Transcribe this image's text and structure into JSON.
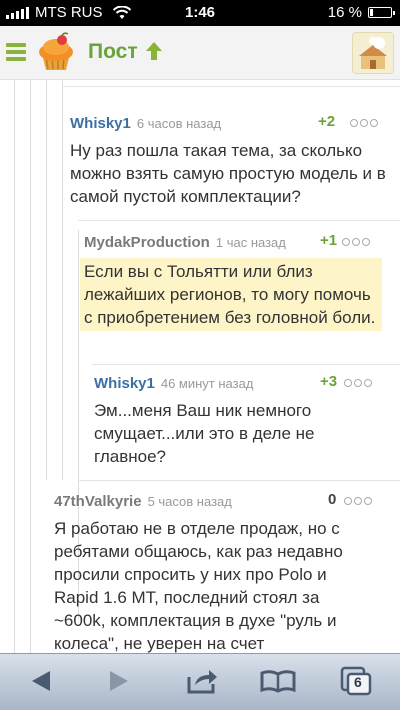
{
  "status_bar": {
    "carrier": "MTS RUS",
    "time": "1:46",
    "battery_text": "16 %",
    "battery_level": 0.16
  },
  "header": {
    "title": "Пост"
  },
  "comments": [
    {
      "author": "Whisky1",
      "time": "6 часов назад",
      "rating": "+2",
      "text": "Ну раз пошла такая тема, за сколько можно взять самую простую модель и в самой пустой комплектации?"
    },
    {
      "author": "MydakProduction",
      "time": "1 час назад",
      "rating": "+1",
      "text": "Если вы с Тольятти или близ лежайших регионов, то могу помочь с приобретением без головной боли."
    },
    {
      "author": "Whisky1",
      "time": "46 минут назад",
      "rating": "+3",
      "text": "Эм...меня Ваш ник немного смущает...или это в деле не главное?"
    },
    {
      "author": "47thValkyrie",
      "time": "5 часов назад",
      "rating": "0",
      "text": "Я работаю не в отделе продаж, но с ребятами общаюсь, как раз недавно просили спросить у них про Polo и Rapid 1.6 МТ, последний стоял за ~600k, комплектация в духе \"руль и колеса\", не уверен на счет"
    }
  ],
  "toolbar": {
    "tabs_count": "6"
  },
  "colors": {
    "accent_green": "#6aa339",
    "author_blue": "#3d6fa6",
    "highlight": "#fdf5c7"
  }
}
